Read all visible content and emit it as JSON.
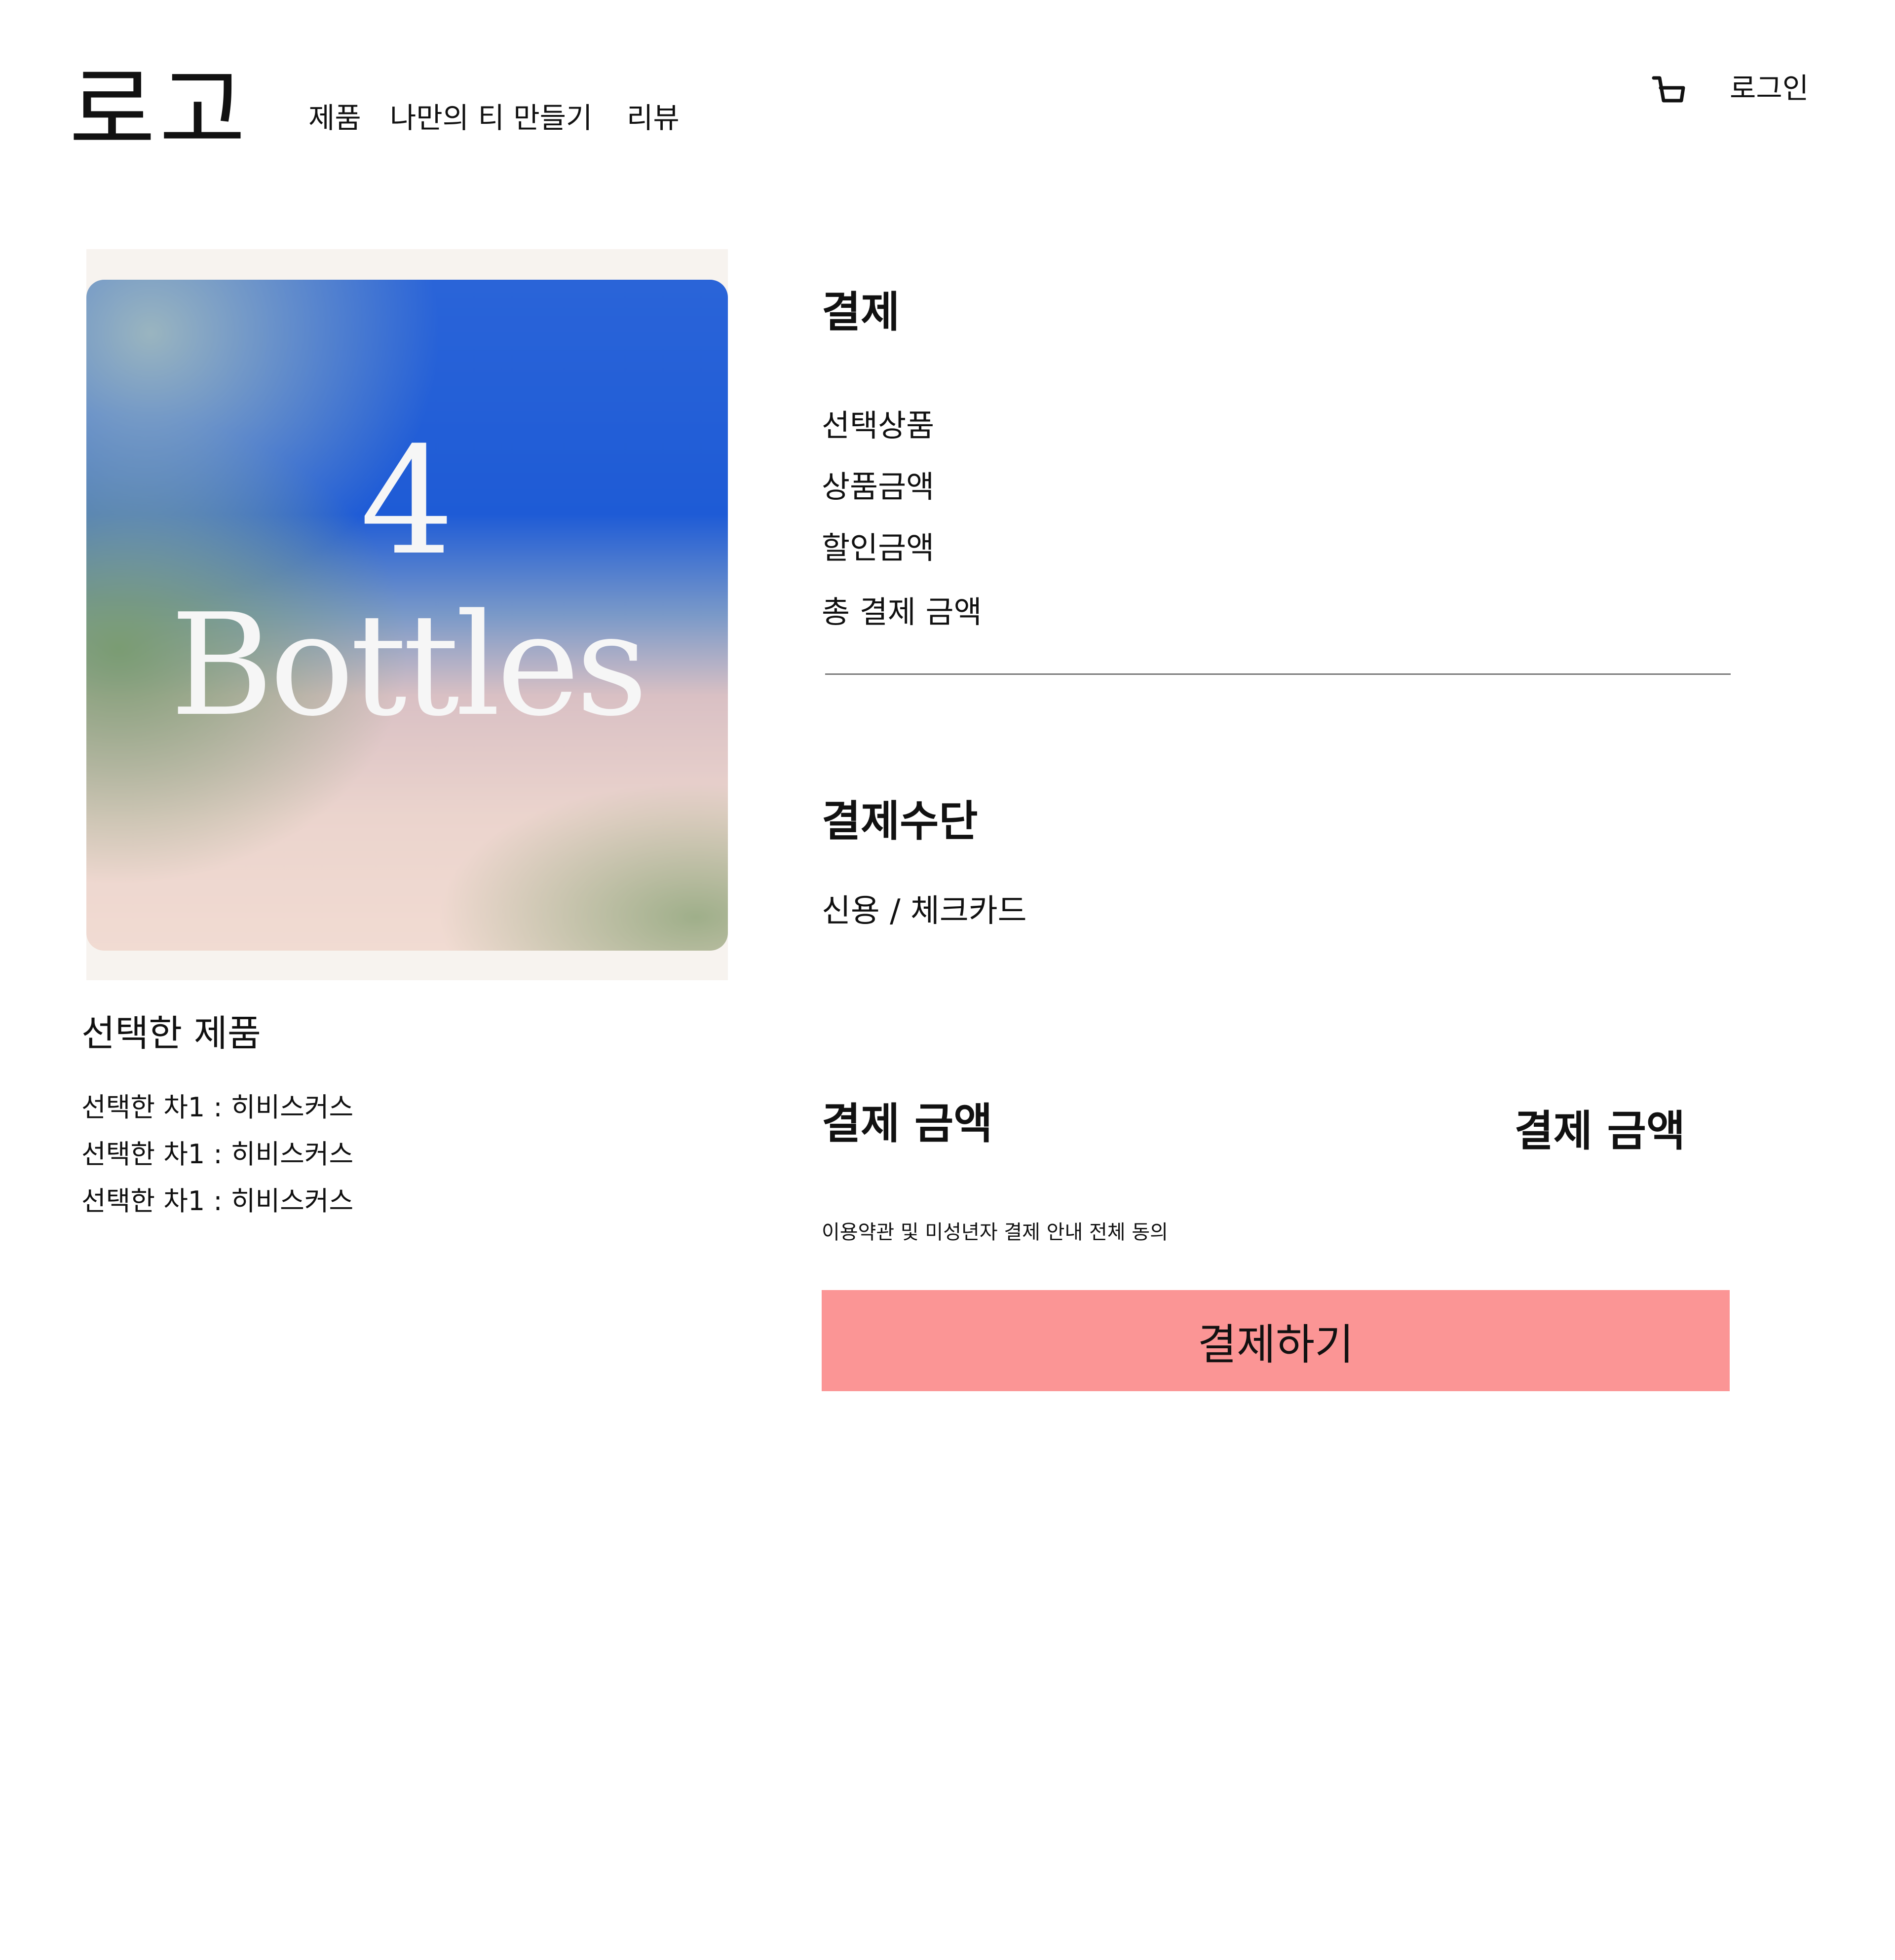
{
  "header": {
    "logo": "로고",
    "nav": [
      "제품",
      "나만의 티 만들기",
      "리뷰"
    ],
    "cart_icon": "cart-icon",
    "login": "로그인"
  },
  "product": {
    "image_number": "4",
    "image_word": "Bottles",
    "selected_title": "선택한 제품",
    "selected_items": [
      "선택한 차1 : 히비스커스",
      "선택한 차1 : 히비스커스",
      "선택한 차1 : 히비스커스"
    ]
  },
  "payment": {
    "title": "결제",
    "summary_labels": [
      "선택상품",
      "상품금액",
      "할인금액",
      "총 결제 금액"
    ],
    "method_title": "결제수단",
    "method": "신용 / 체크카드",
    "amount_label": "결제 금액",
    "amount_value": "결제 금액",
    "terms": "이용약관 및 미성년자 결제 안내 전체 동의",
    "button": "결제하기"
  },
  "colors": {
    "button_bg": "#fb9595",
    "divider": "#7a7a7a",
    "text": "#111111"
  }
}
